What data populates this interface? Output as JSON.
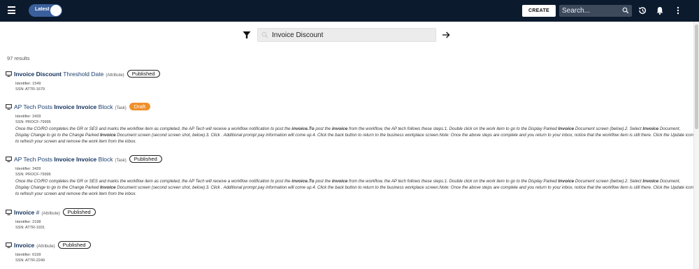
{
  "header": {
    "toggle_label": "Latest",
    "create_label": "CREATE",
    "search_placeholder": "Search...",
    "icons": [
      "menu-icon",
      "search-icon",
      "history-icon",
      "bell-icon",
      "more-vert-icon"
    ]
  },
  "query": {
    "value": "Invoice Discount",
    "icons": [
      "filter-icon",
      "search-icon",
      "arrow-right-icon"
    ]
  },
  "results_count": "97 results",
  "results": [
    {
      "title_parts": [
        [
          "Invoice Discount",
          true
        ],
        [
          " Threshold Date",
          false
        ]
      ],
      "type": "(Attribute)",
      "badge": "Published",
      "identifier": "Identifier: 1549",
      "ssn": "SSN: ATTR-1679"
    },
    {
      "title_parts": [
        [
          "AP Tech Posts ",
          false
        ],
        [
          "Invoice Invoice",
          true
        ],
        [
          " Block",
          false
        ]
      ],
      "type": "(Task)",
      "badge": "Draft",
      "identifier": "Identifier: 3439",
      "ssn": "SSN: PROCF-79995",
      "description_parts": [
        [
          "Once the CO/RO completes the GR or SES and marks the workflow item as completed, the AP Tech will receive a workflow notification to post the ",
          false
        ],
        [
          "invoice.To",
          true
        ],
        [
          " post the ",
          false
        ],
        [
          "invoice",
          true
        ],
        [
          " from the workflow, the AP tech follows these steps:1. Double click on the work item to go to the Display Parked ",
          false
        ],
        [
          "Invoice",
          true
        ],
        [
          " Document screen (below).2. Select ",
          false
        ],
        [
          "Invoice",
          true
        ],
        [
          " Document, Display Change to go to the Change Parked ",
          false
        ],
        [
          "Invoice",
          true
        ],
        [
          " Document screen (second screen shot, below).3. Click . Additional prompt pay information will come up.4. Click the back button to return to the business workplace screen.Note: Once the above steps are complete and you return to your inbox, notice that the workflow item is still there. Click the Update icon to refresh your screen and remove the work item from the inbox.",
          false
        ]
      ]
    },
    {
      "title_parts": [
        [
          "AP Tech Posts ",
          false
        ],
        [
          "Invoice Invoice",
          true
        ],
        [
          " Block",
          false
        ]
      ],
      "type": "(Task)",
      "badge": "Published",
      "identifier": "Identifier: 3439",
      "ssn": "SSN: PROCF-79995",
      "description_parts": [
        [
          "Once the CO/RO completes the GR or SES and marks the workflow item as completed, the AP Tech will receive a workflow notification to post the ",
          false
        ],
        [
          "invoice.To",
          true
        ],
        [
          " post the ",
          false
        ],
        [
          "invoice",
          true
        ],
        [
          " from the workflow, the AP tech follows these steps:1. Double click on the work item to go to the Display Parked ",
          false
        ],
        [
          "Invoice",
          true
        ],
        [
          " Document screen (below).2. Select ",
          false
        ],
        [
          "Invoice",
          true
        ],
        [
          " Document, Display Change to go to the Change Parked ",
          false
        ],
        [
          "Invoice",
          true
        ],
        [
          " Document screen (second screen shot, below).3. Click . Additional prompt pay information will come up.4. Click the back button to return to the business workplace screen.Note: Once the above steps are complete and you return to your inbox, notice that the workflow item is still there. Click the Update icon to refresh your screen and remove the work item from the inbox.",
          false
        ]
      ]
    },
    {
      "title_parts": [
        [
          "Invoice",
          true
        ],
        [
          " #",
          false
        ]
      ],
      "type": "(Attribute)",
      "badge": "Published",
      "identifier": "Identifier: 2198",
      "ssn": "SSN: ATTR-1931"
    },
    {
      "title_parts": [
        [
          "Invoice",
          true
        ]
      ],
      "type": "(Attribute)",
      "badge": "Published",
      "identifier": "Identifier: 6199",
      "ssn": "SSN: ATTR-2249"
    }
  ]
}
